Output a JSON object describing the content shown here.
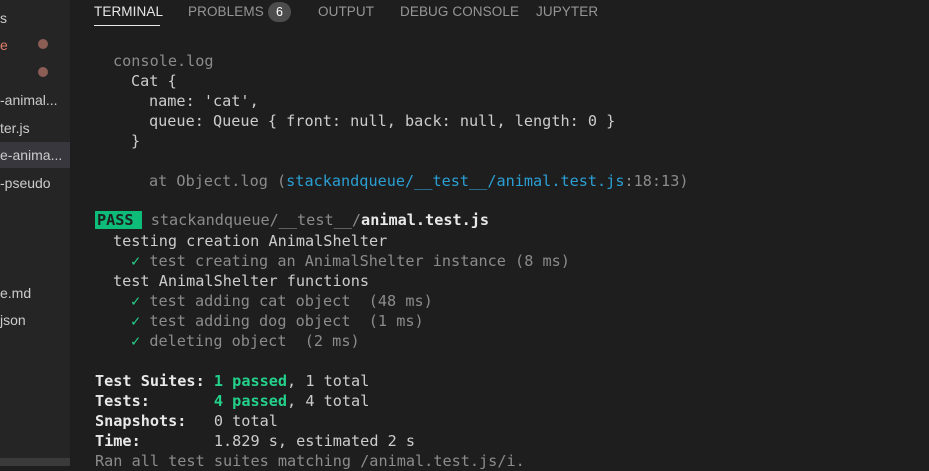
{
  "sidebar": {
    "items": [
      {
        "label": "s"
      },
      {
        "label": "e"
      },
      {
        "label": ""
      },
      {
        "label": "-animal..."
      },
      {
        "label": "ter.js"
      },
      {
        "label": "e-anima..."
      },
      {
        "label": "-pseudo"
      },
      {
        "label": "e.md"
      },
      {
        "label": "json"
      }
    ]
  },
  "tabs": [
    {
      "label": "TERMINAL"
    },
    {
      "label": "PROBLEMS"
    },
    {
      "label": "OUTPUT"
    },
    {
      "label": "DEBUG CONSOLE"
    },
    {
      "label": "JUPYTER"
    }
  ],
  "problems_count": "6",
  "terminal": {
    "console_log": "console.log",
    "cat_open": "Cat {",
    "name_line": "name: 'cat',",
    "queue_line": "queue: Queue { front: null, back: null, length: 0 }",
    "cat_close": "}",
    "at_prefix": "at Object.log (",
    "at_link": "stackandqueue/__test__/animal.test.js",
    "at_suffix": ":18:13)",
    "pass_label": "PASS",
    "pass_path_dir": "stackandqueue/__test__/",
    "pass_path_file": "animal.test.js",
    "describe1": "testing creation AnimalShelter",
    "test1": "test creating an AnimalShelter instance (8 ms)",
    "describe2": "test AnimalShelter functions",
    "test2": "test adding cat object  (48 ms)",
    "test3": "test adding dog object  (1 ms)",
    "test4": "deleting object  (2 ms)",
    "check_glyph": "✓",
    "suites_label": "Test Suites:",
    "suites_passed": "1 passed",
    "suites_total": ", 1 total",
    "tests_label": "Tests:",
    "tests_passed": "4 passed",
    "tests_total": ", 4 total",
    "snapshots_label": "Snapshots:",
    "snapshots_value": "0 total",
    "time_label": "Time:",
    "time_value": "1.829 s, estimated 2 s",
    "ran_line": "Ran all test suites matching /animal.test.js/i."
  },
  "colors": {
    "background": "#1e1e1e",
    "sidebar": "#252526",
    "pass_badge": "#0dbc79",
    "passed_text": "#23d18b",
    "link": "#2b9fd3"
  }
}
